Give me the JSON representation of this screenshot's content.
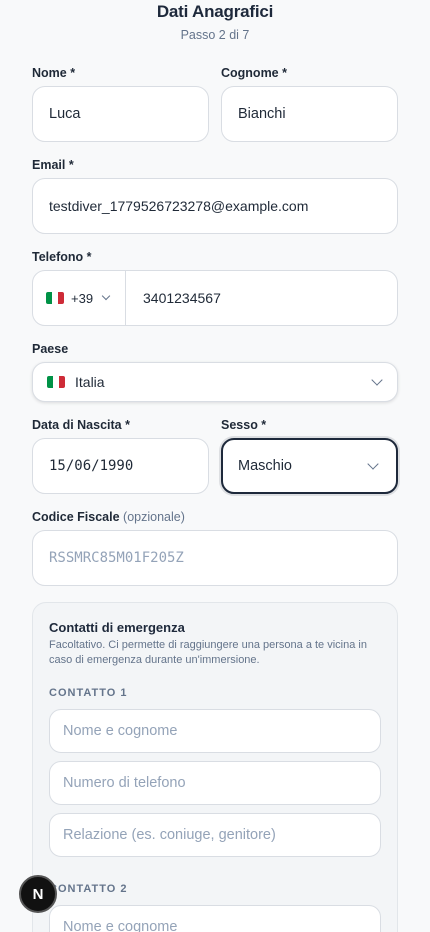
{
  "header": {
    "title": "Dati Anagrafici",
    "step": "Passo 2 di 7"
  },
  "form": {
    "first_name": {
      "label": "Nome *",
      "value": "Luca"
    },
    "last_name": {
      "label": "Cognome *",
      "value": "Bianchi"
    },
    "email": {
      "label": "Email *",
      "value": "testdiver_1779526723278@example.com"
    },
    "phone": {
      "label": "Telefono *",
      "country_code": "+39",
      "value": "3401234567"
    },
    "country": {
      "label": "Paese",
      "value": "Italia"
    },
    "birth_date": {
      "label": "Data di Nascita *",
      "value": "15/06/1990"
    },
    "sex": {
      "label": "Sesso *",
      "value": "Maschio"
    },
    "tax_code": {
      "label": "Codice Fiscale",
      "optional": "(opzionale)",
      "placeholder": "RSSMRC85M01F205Z"
    }
  },
  "emergency": {
    "title": "Contatti di emergenza",
    "description": "Facoltativo. Ci permette di raggiungere una persona a te vicina in caso di emergenza durante un'immersione.",
    "contact1": {
      "heading": "CONTATTO 1",
      "name_placeholder": "Nome e cognome",
      "phone_placeholder": "Numero di telefono",
      "relation_placeholder": "Relazione (es. coniuge, genitore)"
    },
    "contact2": {
      "heading": "CONTATTO 2",
      "name_placeholder": "Nome e cognome"
    }
  },
  "badge": {
    "letter": "N"
  },
  "colors": {
    "flag_green": "#009246",
    "flag_white": "#ffffff",
    "flag_red": "#ce2b37",
    "focus_border": "#1e293b"
  },
  "icons": {
    "chevron": "chevron-down-icon",
    "flag": "italy-flag-icon"
  }
}
